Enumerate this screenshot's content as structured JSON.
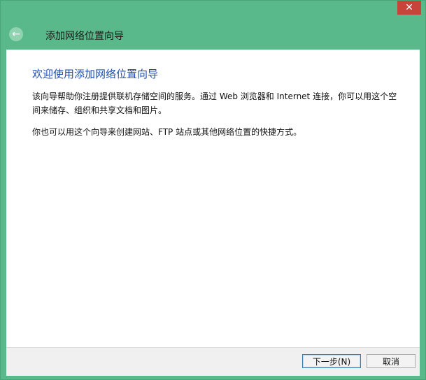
{
  "window": {
    "close_symbol": "✕"
  },
  "wizard": {
    "title": "添加网络位置向导",
    "back_symbol": "←"
  },
  "content": {
    "heading": "欢迎使用添加网络位置向导",
    "paragraph1": "该向导帮助你注册提供联机存储空间的服务。通过 Web 浏览器和 Internet 连接，你可以用这个空间来储存、组织和共享文档和图片。",
    "paragraph2": "你也可以用这个向导来创建网站、FTP 站点或其他网络位置的快捷方式。"
  },
  "buttons": {
    "next": "下一步(N)",
    "cancel": "取消"
  },
  "colors": {
    "frame": "#5ab98a",
    "heading": "#1f4fb5",
    "close": "#c7443a"
  }
}
